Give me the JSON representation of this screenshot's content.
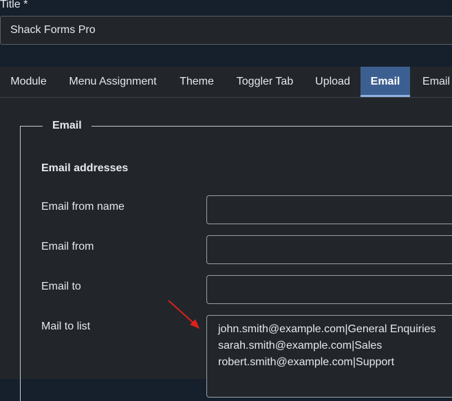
{
  "title_field": {
    "label": "Title *",
    "value": "Shack Forms Pro"
  },
  "tabs": [
    {
      "label": "Module",
      "active": false
    },
    {
      "label": "Menu Assignment",
      "active": false
    },
    {
      "label": "Theme",
      "active": false
    },
    {
      "label": "Toggler Tab",
      "active": false
    },
    {
      "label": "Upload",
      "active": false
    },
    {
      "label": "Email",
      "active": true
    },
    {
      "label": "Email T",
      "active": false
    }
  ],
  "fieldset": {
    "legend": "Email",
    "section_heading": "Email addresses",
    "fields": {
      "email_from_name": {
        "label": "Email from name",
        "value": ""
      },
      "email_from": {
        "label": "Email from",
        "value": ""
      },
      "email_to": {
        "label": "Email to",
        "value": ""
      },
      "mail_to_list": {
        "label": "Mail to list",
        "lines": [
          "john.smith@example.com|General Enquiries",
          "sarah.smith@example.com|Sales",
          "robert.smith@example.com|Support"
        ]
      }
    }
  },
  "colors": {
    "page_background": "#16202d",
    "panel_background": "#22262b",
    "active_tab": "#3c5f91",
    "annotation_arrow": "#e0201b"
  }
}
